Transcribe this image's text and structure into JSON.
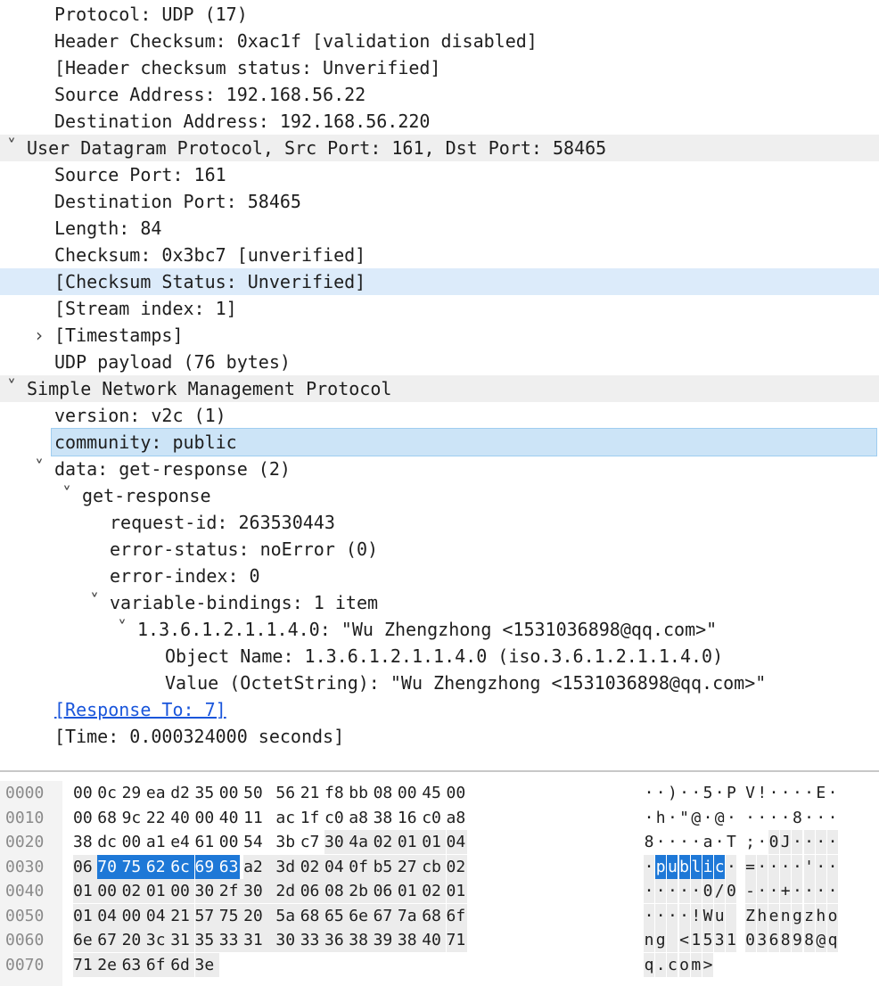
{
  "tree": [
    {
      "text": "Protocol: UDP (17)",
      "indent": 1,
      "toggle": "",
      "style": ""
    },
    {
      "text": "Header Checksum: 0xac1f [validation disabled]",
      "indent": 1,
      "toggle": "",
      "style": ""
    },
    {
      "text": "[Header checksum status: Unverified]",
      "indent": 1,
      "toggle": "",
      "style": ""
    },
    {
      "text": "Source Address: 192.168.56.22",
      "indent": 1,
      "toggle": "",
      "style": ""
    },
    {
      "text": "Destination Address: 192.168.56.220",
      "indent": 1,
      "toggle": "",
      "style": ""
    },
    {
      "text": "User Datagram Protocol, Src Port: 161, Dst Port: 58465",
      "indent": 0,
      "toggle": "open",
      "style": "hdr"
    },
    {
      "text": "Source Port: 161",
      "indent": 1,
      "toggle": "",
      "style": ""
    },
    {
      "text": "Destination Port: 58465",
      "indent": 1,
      "toggle": "",
      "style": ""
    },
    {
      "text": "Length: 84",
      "indent": 1,
      "toggle": "",
      "style": ""
    },
    {
      "text": "Checksum: 0x3bc7 [unverified]",
      "indent": 1,
      "toggle": "",
      "style": ""
    },
    {
      "text": "[Checksum Status: Unverified]",
      "indent": 1,
      "toggle": "",
      "style": "sel"
    },
    {
      "text": "[Stream index: 1]",
      "indent": 1,
      "toggle": "",
      "style": ""
    },
    {
      "text": "[Timestamps]",
      "indent": 1,
      "toggle": "closed",
      "style": ""
    },
    {
      "text": "UDP payload (76 bytes)",
      "indent": 1,
      "toggle": "",
      "style": ""
    },
    {
      "text": "Simple Network Management Protocol",
      "indent": 0,
      "toggle": "open",
      "style": "hdr"
    },
    {
      "text": "version: v2c (1)",
      "indent": 1,
      "toggle": "",
      "style": ""
    },
    {
      "text": "community: public",
      "indent": 1,
      "toggle": "",
      "style": "cur"
    },
    {
      "text": "data: get-response (2)",
      "indent": 1,
      "toggle": "open",
      "style": ""
    },
    {
      "text": "get-response",
      "indent": 2,
      "toggle": "open",
      "style": ""
    },
    {
      "text": "request-id: 263530443",
      "indent": 3,
      "toggle": "",
      "style": ""
    },
    {
      "text": "error-status: noError (0)",
      "indent": 3,
      "toggle": "",
      "style": ""
    },
    {
      "text": "error-index: 0",
      "indent": 3,
      "toggle": "",
      "style": ""
    },
    {
      "text": "variable-bindings: 1 item",
      "indent": 3,
      "toggle": "open",
      "style": ""
    },
    {
      "text": "1.3.6.1.2.1.1.4.0: \"Wu Zhengzhong <1531036898@qq.com>\"",
      "indent": 4,
      "toggle": "open",
      "style": ""
    },
    {
      "text": "Object Name: 1.3.6.1.2.1.1.4.0 (iso.3.6.1.2.1.1.4.0)",
      "indent": 5,
      "toggle": "",
      "style": ""
    },
    {
      "text": "Value (OctetString): \"Wu Zhengzhong <1531036898@qq.com>\"",
      "indent": 5,
      "toggle": "",
      "style": ""
    },
    {
      "text": "[Response To: 7]",
      "indent": 1,
      "toggle": "",
      "style": "link"
    },
    {
      "text": "[Time: 0.000324000 seconds]",
      "indent": 1,
      "toggle": "",
      "style": ""
    }
  ],
  "hex_rows": [
    {
      "offset": "0000",
      "bytes": [
        "00",
        "0c",
        "29",
        "ea",
        "d2",
        "35",
        "00",
        "50",
        "56",
        "21",
        "f8",
        "bb",
        "08",
        "00",
        "45",
        "00"
      ],
      "ascii": [
        "·",
        "·",
        ")",
        "·",
        "·",
        "5",
        "·",
        "P",
        "V",
        "!",
        "·",
        "·",
        "·",
        "·",
        "E",
        "·"
      ]
    },
    {
      "offset": "0010",
      "bytes": [
        "00",
        "68",
        "9c",
        "22",
        "40",
        "00",
        "40",
        "11",
        "ac",
        "1f",
        "c0",
        "a8",
        "38",
        "16",
        "c0",
        "a8"
      ],
      "ascii": [
        "·",
        "h",
        "·",
        "\"",
        "@",
        "·",
        "@",
        "·",
        "·",
        "·",
        "·",
        "·",
        "8",
        "·",
        "·",
        "·"
      ]
    },
    {
      "offset": "0020",
      "bytes": [
        "38",
        "dc",
        "00",
        "a1",
        "e4",
        "61",
        "00",
        "54",
        "3b",
        "c7",
        "30",
        "4a",
        "02",
        "01",
        "01",
        "04"
      ],
      "ascii": [
        "8",
        "·",
        "·",
        "·",
        "·",
        "a",
        "·",
        "T",
        ";",
        "·",
        "0",
        "J",
        "·",
        "·",
        "·",
        "·"
      ]
    },
    {
      "offset": "0030",
      "bytes": [
        "06",
        "70",
        "75",
        "62",
        "6c",
        "69",
        "63",
        "a2",
        "3d",
        "02",
        "04",
        "0f",
        "b5",
        "27",
        "cb",
        "02"
      ],
      "ascii": [
        "·",
        "p",
        "u",
        "b",
        "l",
        "i",
        "c",
        "·",
        "=",
        "·",
        "·",
        "·",
        "·",
        "'",
        "·",
        "·"
      ]
    },
    {
      "offset": "0040",
      "bytes": [
        "01",
        "00",
        "02",
        "01",
        "00",
        "30",
        "2f",
        "30",
        "2d",
        "06",
        "08",
        "2b",
        "06",
        "01",
        "02",
        "01"
      ],
      "ascii": [
        "·",
        "·",
        "·",
        "·",
        "·",
        "0",
        "/",
        "0",
        "-",
        "·",
        "·",
        "+",
        "·",
        "·",
        "·",
        "·"
      ]
    },
    {
      "offset": "0050",
      "bytes": [
        "01",
        "04",
        "00",
        "04",
        "21",
        "57",
        "75",
        "20",
        "5a",
        "68",
        "65",
        "6e",
        "67",
        "7a",
        "68",
        "6f"
      ],
      "ascii": [
        "·",
        "·",
        "·",
        "·",
        "!",
        "W",
        "u",
        " ",
        "Z",
        "h",
        "e",
        "n",
        "g",
        "z",
        "h",
        "o"
      ]
    },
    {
      "offset": "0060",
      "bytes": [
        "6e",
        "67",
        "20",
        "3c",
        "31",
        "35",
        "33",
        "31",
        "30",
        "33",
        "36",
        "38",
        "39",
        "38",
        "40",
        "71"
      ],
      "ascii": [
        "n",
        "g",
        " ",
        "<",
        "1",
        "5",
        "3",
        "1",
        "0",
        "3",
        "6",
        "8",
        "9",
        "8",
        "@",
        "q"
      ]
    },
    {
      "offset": "0070",
      "bytes": [
        "71",
        "2e",
        "63",
        "6f",
        "6d",
        "3e"
      ],
      "ascii": [
        "q",
        ".",
        "c",
        "o",
        "m",
        ">"
      ]
    }
  ],
  "highlight": {
    "start": 49,
    "end": 54
  },
  "colors": {
    "selection": "#1e78d7",
    "row_selected": "#dcebfa",
    "section_header": "#efefef",
    "link": "#1a56db"
  }
}
